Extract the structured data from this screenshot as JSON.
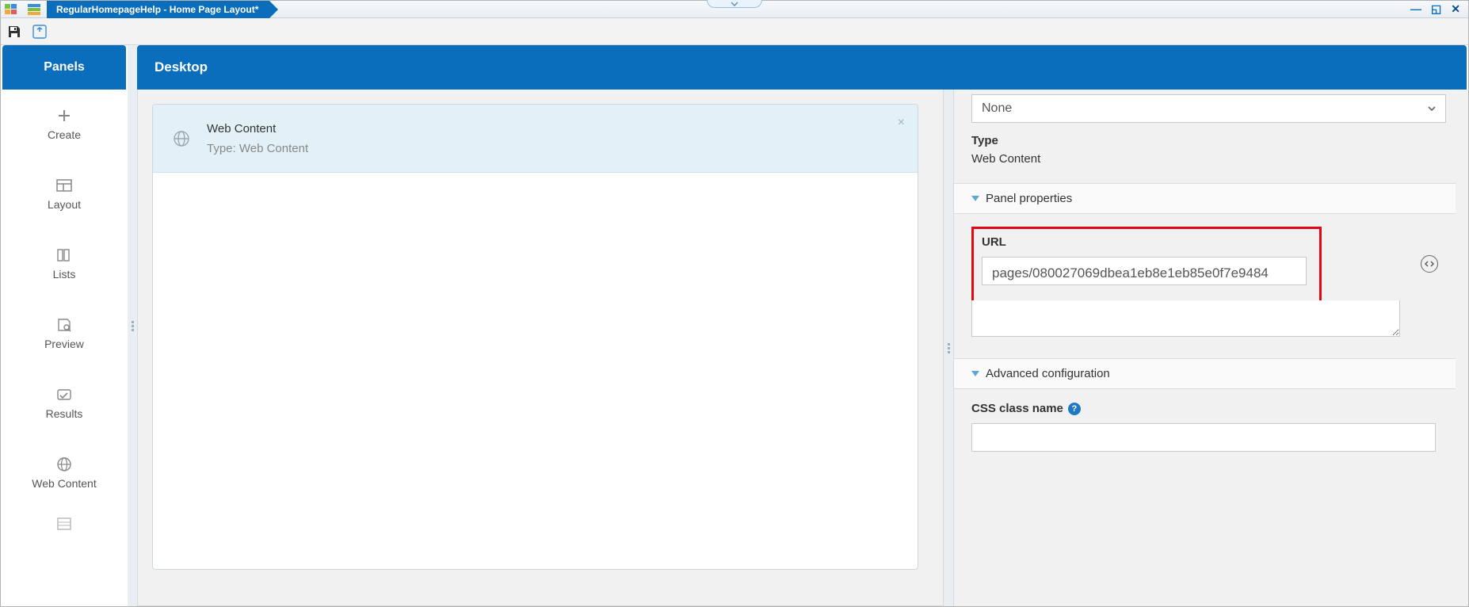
{
  "window": {
    "tab_title": "RegularHomepageHelp - Home Page Layout*"
  },
  "sidebar": {
    "header": "Panels",
    "items": [
      {
        "label": "Create"
      },
      {
        "label": "Layout"
      },
      {
        "label": "Lists"
      },
      {
        "label": "Preview"
      },
      {
        "label": "Results"
      },
      {
        "label": "Web Content"
      }
    ]
  },
  "main": {
    "header": "Desktop",
    "widget": {
      "title": "Web Content",
      "subtitle": "Type: Web Content"
    }
  },
  "props": {
    "select_value": "None",
    "type_label": "Type",
    "type_value": "Web Content",
    "section_panel": "Panel properties",
    "url_label": "URL",
    "url_value": "pages/080027069dbea1eb8e1eb85e0f7e9484",
    "section_adv": "Advanced configuration",
    "css_label": "CSS class name",
    "css_value": ""
  }
}
